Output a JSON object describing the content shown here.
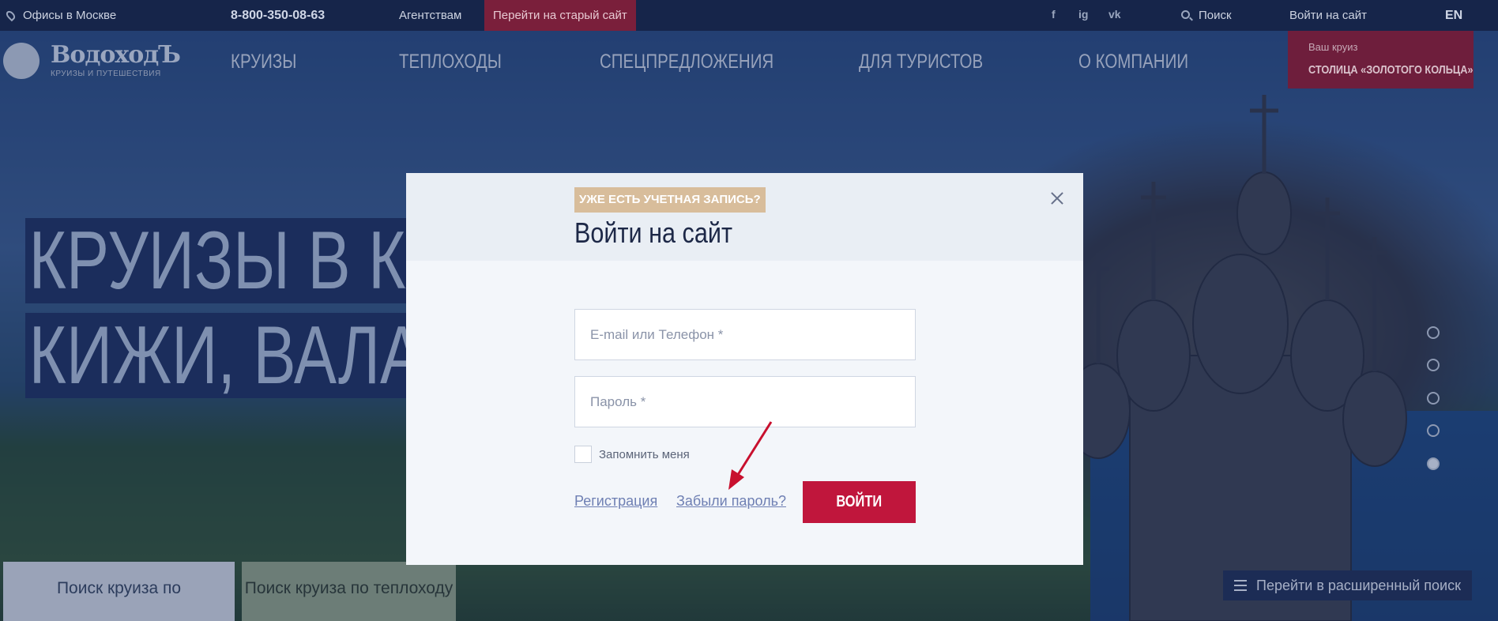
{
  "topbar": {
    "offices": "Офисы в Москве",
    "phone": "8-800-350-08-63",
    "agencies": "Агентствам",
    "old_site": "Перейти на старый сайт",
    "social": [
      "f",
      "ig",
      "vk"
    ],
    "search": "Поиск",
    "login": "Войти на сайт",
    "lang": "EN"
  },
  "header": {
    "logo_name": "ВодоходЪ",
    "logo_sub": "КРУИЗЫ И ПУТЕШЕСТВИЯ",
    "nav": [
      "КРУИЗЫ",
      "ТЕПЛОХОДЫ",
      "СПЕЦПРЕДЛОЖЕНИЯ",
      "ДЛЯ ТУРИСТОВ",
      "О КОМПАНИИ"
    ],
    "your_cruise_label": "Ваш круиз",
    "your_cruise_value": "СТОЛИЦА «ЗОЛОТОГО КОЛЬЦА»"
  },
  "hero": {
    "line1": "КРУИЗЫ В КА",
    "line2": "КИЖИ, ВАЛА",
    "dots_count": 5,
    "active_dot": 5
  },
  "bottom": {
    "tab_direction": "Поиск круиза по направлению",
    "tab_ship": "Поиск круиза по теплоходу",
    "advanced_search": "Перейти в расширенный поиск"
  },
  "modal": {
    "badge": "УЖЕ ЕСТЬ УЧЕТНАЯ ЗАПИСЬ?",
    "title": "Войти на сайт",
    "email_placeholder": "E-mail или Телефон *",
    "password_placeholder": "Пароль *",
    "remember": "Запомнить меня",
    "register": "Регистрация",
    "forgot": "Забыли пароль?",
    "submit": "ВОЙТИ"
  },
  "colors": {
    "accent": "#c0163c",
    "badge": "#d8bd9b",
    "topbar": "#16254a",
    "arrow": "#c8102e"
  }
}
